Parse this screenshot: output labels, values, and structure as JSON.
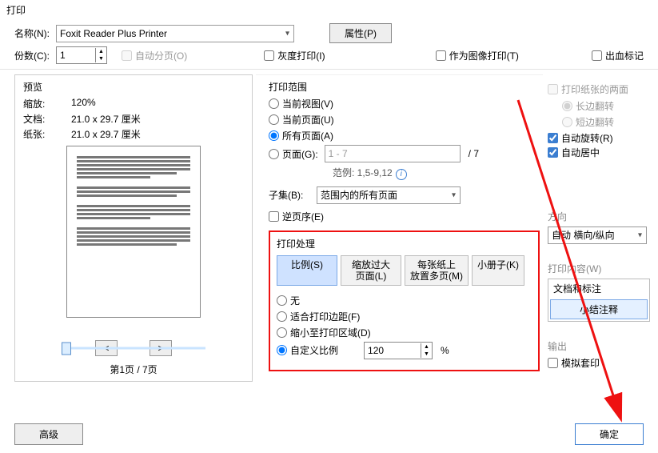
{
  "window_title": "打印",
  "top": {
    "name_label": "名称(N):",
    "printer": "Foxit Reader Plus Printer",
    "properties_btn": "属性(P)",
    "copies_label": "份数(C):",
    "copies_value": "1",
    "collate": "自动分页(O)",
    "grayscale": "灰度打印(I)",
    "as_image": "作为图像打印(T)",
    "bleed_marks": "出血标记"
  },
  "preview": {
    "title": "预览",
    "zoom_label": "缩放:",
    "zoom_value": "120%",
    "doc_label": "文档:",
    "doc_value": "21.0 x 29.7 厘米",
    "paper_label": "纸张:",
    "paper_value": "21.0 x 29.7 厘米",
    "nav_prev": "<",
    "nav_next": ">",
    "pager": "第1页 / 7页"
  },
  "range": {
    "title": "打印范围",
    "current_view": "当前视图(V)",
    "current_page": "当前页面(U)",
    "all_pages": "所有页面(A)",
    "pages_label": "页面(G):",
    "pages_value": "1 - 7",
    "pages_total": "/ 7",
    "hint": "范例: 1,5-9,12",
    "subset_label": "子集(B):",
    "subset_value": "范围内的所有页面",
    "reverse": "逆页序(E)",
    "selected": "all_pages"
  },
  "handling": {
    "title": "打印处理",
    "tabs": {
      "scale": "比例(S)",
      "fit_oversize": "缩放过大\n页面(L)",
      "multiple": "每张纸上\n放置多页(M)",
      "booklet": "小册子(K)"
    },
    "scale_opts": {
      "none": "无",
      "fit_margins": "适合打印边距(F)",
      "shrink": "缩小至打印区域(D)",
      "custom": "自定义比例",
      "custom_value": "120",
      "percent": "%"
    },
    "selected_tab": "scale",
    "selected_scale": "custom"
  },
  "right": {
    "duplex_title": "打印纸张的两面",
    "long_edge": "长边翻转",
    "short_edge": "短边翻转",
    "auto_rotate": "自动旋转(R)",
    "auto_center": "自动居中",
    "orientation_title": "方向",
    "orientation_value": "自动 横向/纵向",
    "content_title": "打印内容(W)",
    "content_value": "文档和标注",
    "content_note": "小结注释",
    "output_title": "输出",
    "simulate": "模拟套印"
  },
  "footer": {
    "advanced": "高级",
    "ok": "确定"
  }
}
